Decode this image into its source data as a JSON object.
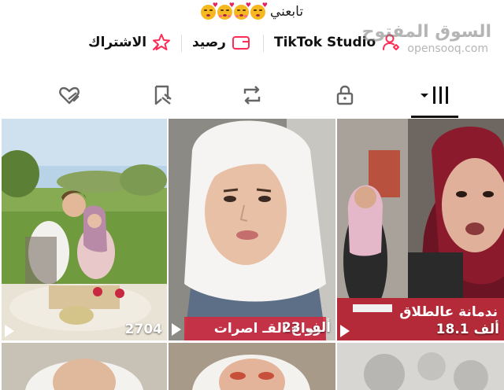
{
  "profile": {
    "bio_text": "تابعني",
    "bio_emojis": [
      "face-blowing-kiss-icon",
      "smiling-face-with-hearts-icon",
      "smiling-face-with-hearts-icon",
      "face-blowing-kiss-icon"
    ]
  },
  "actions": {
    "studio_label": "TikTok Studio",
    "balance_label": "رصيد",
    "subscription_label": "الاشتراك"
  },
  "watermark": {
    "arabic": "السوق المفتوح",
    "latin": "opensooq.com"
  },
  "tabs": [
    {
      "icon": "grid-icon",
      "selected": true
    },
    {
      "icon": "lock-icon",
      "selected": false
    },
    {
      "icon": "repost-icon",
      "selected": false
    },
    {
      "icon": "bookmark-icon",
      "selected": false
    },
    {
      "icon": "liked-icon",
      "selected": false
    }
  ],
  "videos": [
    {
      "views": "2704",
      "caption": ""
    },
    {
      "views": "23 ألف",
      "caption": "زواج القـ اصرات"
    },
    {
      "views": "18.1 ألف",
      "caption": "ندمانة عالطلاق"
    },
    {
      "views": "",
      "caption": ""
    },
    {
      "views": "",
      "caption": ""
    },
    {
      "views": "",
      "caption": ""
    }
  ],
  "colors": {
    "accent_pink": "#fe2c55",
    "selected_tab": "#111111",
    "caption_red": "#d6283c"
  }
}
